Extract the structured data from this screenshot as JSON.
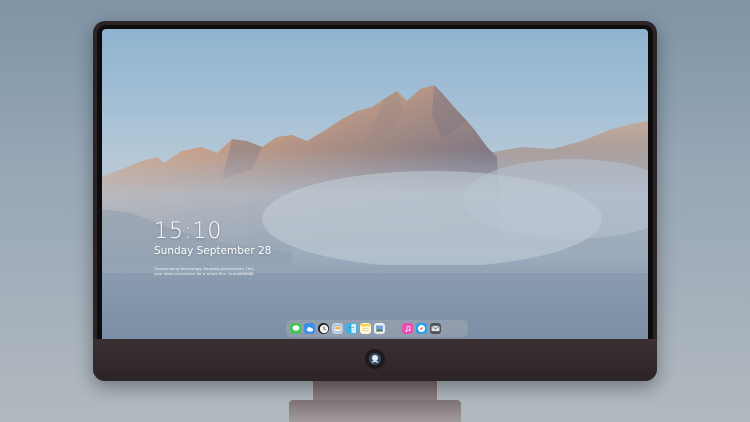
{
  "lock_screen": {
    "time": "15:10",
    "date": "Sunday September 28",
    "caption_line1": "Transcending technology. Amazing productivity. This,",
    "caption_line2": "your ideal companion for a whole film. Score888888"
  },
  "dock": {
    "items": [
      {
        "name": "messages",
        "icon": "messages-icon",
        "color": "#4cc15a"
      },
      {
        "name": "weather",
        "icon": "weather-icon",
        "color": "#3b8fe6"
      },
      {
        "name": "clock",
        "icon": "clock-icon",
        "color": "#f2f2f2"
      },
      {
        "name": "preview",
        "icon": "preview-icon",
        "color": "#bcd3ea"
      },
      {
        "name": "finder",
        "icon": "finder-icon",
        "color": "#38b3e8"
      },
      {
        "name": "notes",
        "icon": "notes-icon",
        "color": "#f5d447"
      },
      {
        "name": "photos",
        "icon": "photos-icon",
        "color": "#7aa2d8"
      },
      {
        "name": "itunes",
        "icon": "itunes-icon",
        "color": "#e44fb0"
      },
      {
        "name": "safari",
        "icon": "safari-icon",
        "color": "#2d9ee8"
      },
      {
        "name": "mail",
        "icon": "mail-icon",
        "color": "#4a4f58"
      }
    ]
  },
  "monitor": {
    "frame_color": "#2a2426",
    "logo_icon": "apple-logo-icon"
  }
}
